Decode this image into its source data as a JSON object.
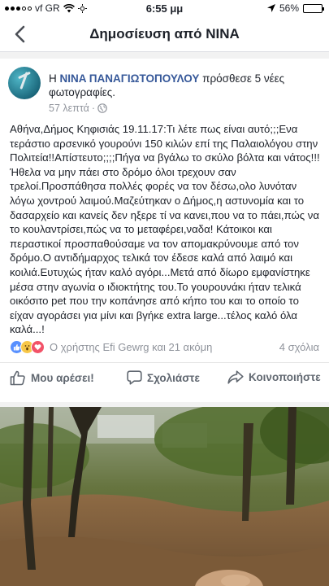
{
  "status_bar": {
    "carrier": "vf GR",
    "time": "6:55 μμ",
    "battery": "56%",
    "battery_level": 0.56
  },
  "nav": {
    "title": "Δημοσίευση από NINA"
  },
  "post": {
    "author": "NINA ΠΑΝΑΓΙΩΤΟΠΟΥΛΟΥ",
    "header_prefix": "Η",
    "header_action": "πρόσθεσε 5 νέες φωτογραφίες.",
    "timestamp": "57 λεπτά",
    "separator": "·",
    "body": "Αθήνα,Δήμος Κηφισιάς 19.11.17:Τι λέτε πως είναι αυτό;;;Ενα τεράστιο αρσενικό γουρούνι 150 κιλών επί της Παλαιολόγου στην Πολιτεία!!Απίστευτο;;;;Πήγα να βγάλω το σκύλο βόλτα και νάτος!!!Ήθελα να μην πάει στο δρόμο όλοι τρεχουν σαν τρελοί.Προσπάθησα πολλές φορές να τον δέσω,ολο λυνόταν λόγω χοντρού λαιμού.Μαζεύτηκαν ο Δήμος,η αστυνομία και το δασαρχείο και κανείς δεν ηξερε τί να κανει,που να το πάει,πώς να το κουλαντρίσει,πώς να το μεταφέρει,ναδα! Κάτοικοι και περαστικοί προσπαθούσαμε να τον απομακρύνουμε από τον δρόμο.Ο αντιδήμαρχος τελικά τον έδεσε καλά από λαιμό και κοιλιά.Ευτυχώς ήταν καλό αγόρι...Μετά από δίωρο εμφανίστηκε μέσα στην αγωνία ο ιδιοκτήτης του.Το γουρουνάκι ήταν τελικά οικόσιτο pet που την κοπάνησε από κήπο του και το οποίο το είχαν αγοράσει για μίνι και βγήκε extra large...τέλος καλό όλα καλά...!",
    "reactions_text": "Ο χρήστης Efi Gewrg και 21 ακόμη",
    "comments_count": "4 σχόλια"
  },
  "actions": {
    "like_label": "Μου αρέσει!",
    "comment_label": "Σχολιάστε",
    "share_label": "Κοινοποιήστε"
  },
  "icons": {
    "back": "chevron-left-icon",
    "globe": "globe-icon",
    "like": "thumbs-up-icon",
    "comment": "comment-bubble-icon",
    "share": "share-arrow-icon"
  },
  "colors": {
    "link": "#365899",
    "accent_blue": "#4267b2",
    "meta_gray": "#90949c"
  }
}
